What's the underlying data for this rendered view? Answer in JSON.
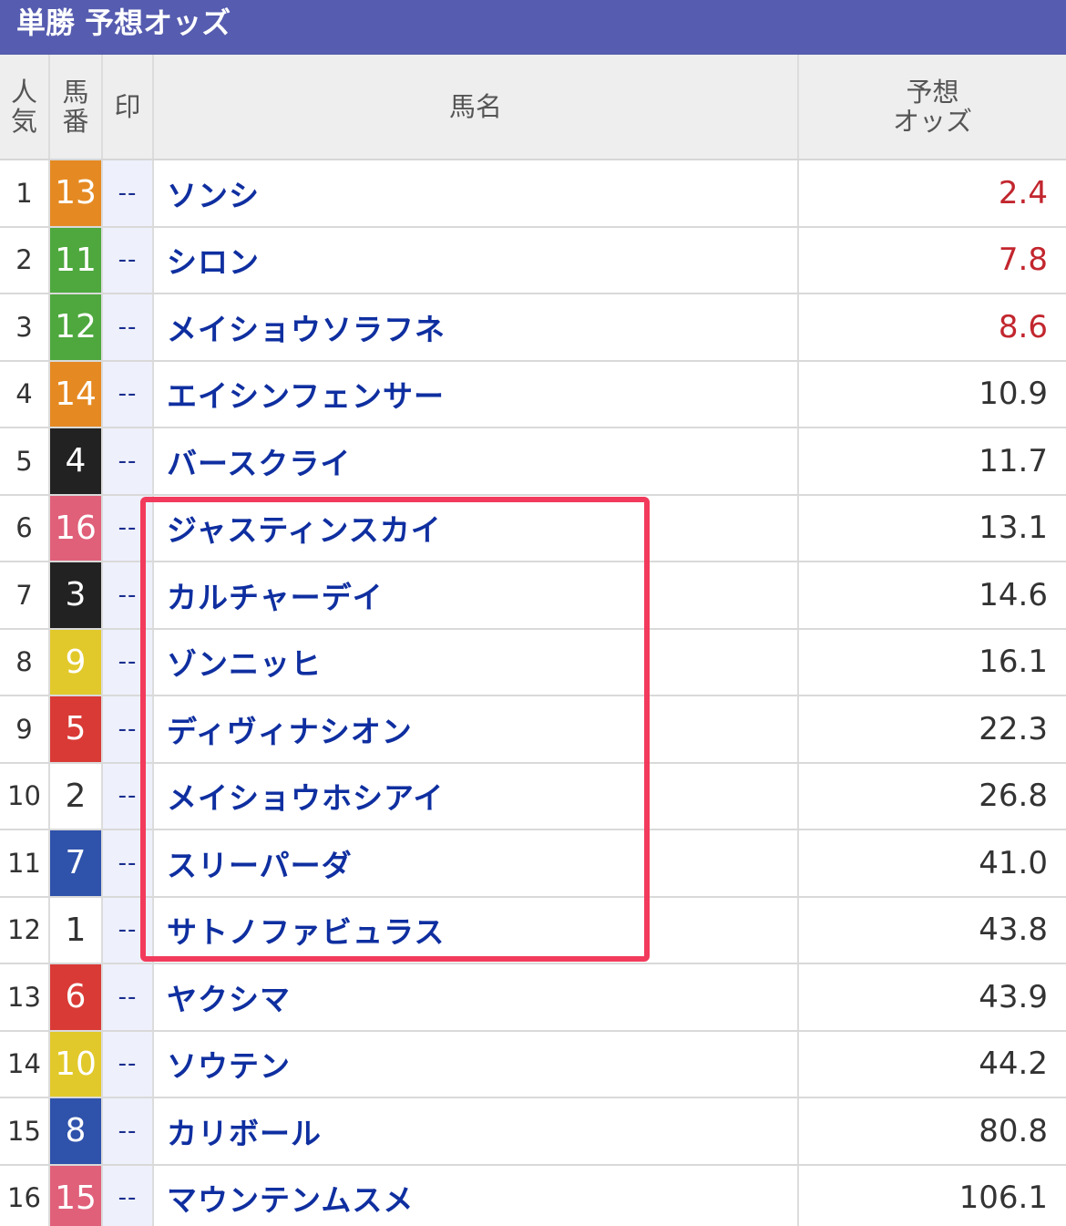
{
  "header": {
    "title": "単勝 予想オッズ"
  },
  "columns": {
    "ninki": [
      "人",
      "気"
    ],
    "umaban": [
      "馬",
      "番"
    ],
    "shirushi": "印",
    "name": "馬名",
    "odds": [
      "予想",
      "オッズ"
    ]
  },
  "frame_colors": {
    "1": {
      "bg": "#ffffff",
      "fg": "#333333"
    },
    "2": {
      "bg": "#222222",
      "fg": "#ffffff"
    },
    "3": {
      "bg": "#d93a36",
      "fg": "#ffffff"
    },
    "4": {
      "bg": "#2f52ab",
      "fg": "#ffffff"
    },
    "5": {
      "bg": "#e2c92b",
      "fg": "#ffffff"
    },
    "6": {
      "bg": "#4ea83e",
      "fg": "#ffffff"
    },
    "7": {
      "bg": "#e58a23",
      "fg": "#ffffff"
    },
    "8": {
      "bg": "#e0607a",
      "fg": "#ffffff"
    }
  },
  "odds_hot_color": "#c2262e",
  "highlight_color": "#f23b5c",
  "rows": [
    {
      "ninki": "1",
      "umaban": "13",
      "frame": 7,
      "shirushi": "--",
      "name": "ソンシ",
      "odds": "2.4",
      "hot": true
    },
    {
      "ninki": "2",
      "umaban": "11",
      "frame": 6,
      "shirushi": "--",
      "name": "シロン",
      "odds": "7.8",
      "hot": true
    },
    {
      "ninki": "3",
      "umaban": "12",
      "frame": 6,
      "shirushi": "--",
      "name": "メイショウソラフネ",
      "odds": "8.6",
      "hot": true
    },
    {
      "ninki": "4",
      "umaban": "14",
      "frame": 7,
      "shirushi": "--",
      "name": "エイシンフェンサー",
      "odds": "10.9",
      "hot": false
    },
    {
      "ninki": "5",
      "umaban": "4",
      "frame": 2,
      "shirushi": "--",
      "name": "バースクライ",
      "odds": "11.7",
      "hot": false
    },
    {
      "ninki": "6",
      "umaban": "16",
      "frame": 8,
      "shirushi": "--",
      "name": "ジャスティンスカイ",
      "odds": "13.1",
      "hot": false
    },
    {
      "ninki": "7",
      "umaban": "3",
      "frame": 2,
      "shirushi": "--",
      "name": "カルチャーデイ",
      "odds": "14.6",
      "hot": false
    },
    {
      "ninki": "8",
      "umaban": "9",
      "frame": 5,
      "shirushi": "--",
      "name": "ゾンニッヒ",
      "odds": "16.1",
      "hot": false
    },
    {
      "ninki": "9",
      "umaban": "5",
      "frame": 3,
      "shirushi": "--",
      "name": "ディヴィナシオン",
      "odds": "22.3",
      "hot": false
    },
    {
      "ninki": "10",
      "umaban": "2",
      "frame": 1,
      "shirushi": "--",
      "name": "メイショウホシアイ",
      "odds": "26.8",
      "hot": false
    },
    {
      "ninki": "11",
      "umaban": "7",
      "frame": 4,
      "shirushi": "--",
      "name": "スリーパーダ",
      "odds": "41.0",
      "hot": false
    },
    {
      "ninki": "12",
      "umaban": "1",
      "frame": 1,
      "shirushi": "--",
      "name": "サトノファビュラス",
      "odds": "43.8",
      "hot": false
    },
    {
      "ninki": "13",
      "umaban": "6",
      "frame": 3,
      "shirushi": "--",
      "name": "ヤクシマ",
      "odds": "43.9",
      "hot": false
    },
    {
      "ninki": "14",
      "umaban": "10",
      "frame": 5,
      "shirushi": "--",
      "name": "ソウテン",
      "odds": "44.2",
      "hot": false
    },
    {
      "ninki": "15",
      "umaban": "8",
      "frame": 4,
      "shirushi": "--",
      "name": "カリボール",
      "odds": "80.8",
      "hot": false
    },
    {
      "ninki": "16",
      "umaban": "15",
      "frame": 8,
      "shirushi": "--",
      "name": "マウンテンムスメ",
      "odds": "106.1",
      "hot": false
    }
  ]
}
